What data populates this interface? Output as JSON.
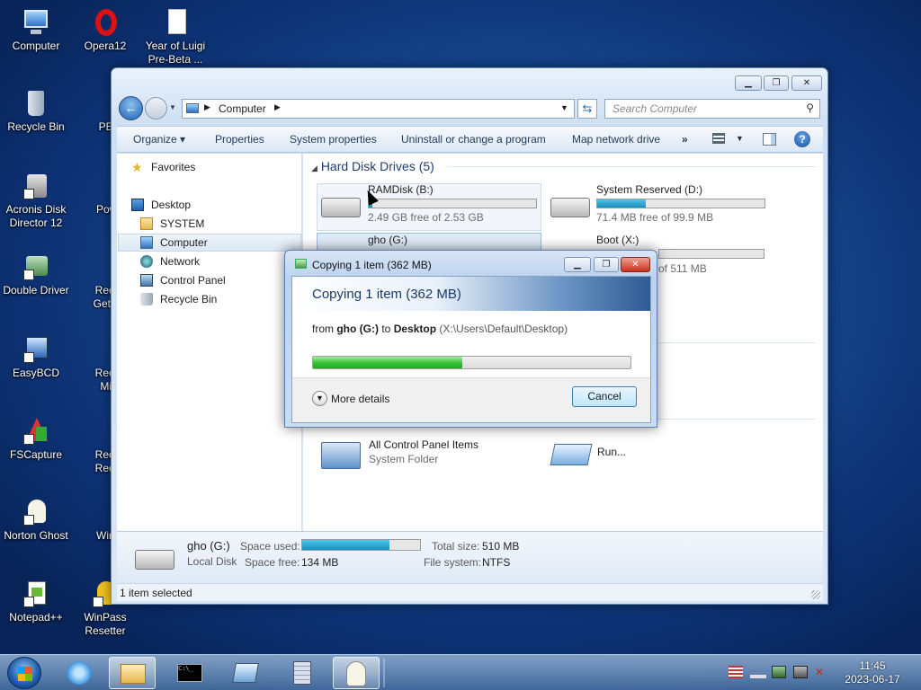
{
  "desktop": {
    "icons": [
      {
        "label": "Computer"
      },
      {
        "label": "Opera12"
      },
      {
        "label": "Year of Luigi Pre-Beta ..."
      },
      {
        "label": "Recycle Bin"
      },
      {
        "label": "PENet"
      },
      {
        "label": "Acronis Disk Director 12"
      },
      {
        "label": "Power"
      },
      {
        "label": "Double Driver"
      },
      {
        "label": "Recove GetData"
      },
      {
        "label": "EasyBCD"
      },
      {
        "label": "Recove MiniT"
      },
      {
        "label": "FSCapture"
      },
      {
        "label": "Recove Recove"
      },
      {
        "label": "Norton Ghost"
      },
      {
        "label": "WinDi"
      },
      {
        "label": "Notepad++"
      },
      {
        "label": "WinPass Resetter"
      }
    ]
  },
  "explorer": {
    "breadcrumb": "Computer",
    "search_placeholder": "Search Computer",
    "toolbar": {
      "organize": "Organize",
      "properties": "Properties",
      "system_properties": "System properties",
      "uninstall": "Uninstall or change a program",
      "map_drive": "Map network drive",
      "more": "»"
    },
    "nav": {
      "favorites": "Favorites",
      "desktop": "Desktop",
      "system": "SYSTEM",
      "computer": "Computer",
      "network": "Network",
      "control_panel": "Control Panel",
      "recycle_bin": "Recycle Bin"
    },
    "section_header": "Hard Disk Drives (5)",
    "drives": [
      {
        "name": "RAMDisk (B:)",
        "free": "2.49 GB free of 2.53 GB",
        "used_fraction": 0.02
      },
      {
        "name": "System Reserved (D:)",
        "free": "71.4 MB free of 99.9 MB",
        "used_fraction": 0.29
      },
      {
        "name": "gho (G:)"
      },
      {
        "name": "Boot (X:)",
        "free": "of 511 MB"
      }
    ],
    "other_items": [
      {
        "name": "All Control Panel Items",
        "sub": "System Folder"
      },
      {
        "name": "Run..."
      }
    ],
    "details": {
      "name": "gho (G:)",
      "type": "Local Disk",
      "space_used_label": "Space used:",
      "space_used_fraction": 0.74,
      "space_free_label": "Space free:",
      "space_free": "134 MB",
      "total_size_label": "Total size:",
      "total_size": "510 MB",
      "fs_label": "File system:",
      "fs": "NTFS"
    },
    "status": "1 item selected"
  },
  "copy_dialog": {
    "title": "Copying 1 item (362 MB)",
    "heading": "Copying 1 item (362 MB)",
    "from": "from",
    "source": "gho (G:)",
    "to": "to",
    "dest": "Desktop",
    "dest_path": "(X:\\Users\\Default\\Desktop)",
    "progress_fraction": 0.47,
    "more_details": "More details",
    "cancel": "Cancel"
  },
  "taskbar": {
    "time": "11:45",
    "date": "2023-06-17"
  }
}
